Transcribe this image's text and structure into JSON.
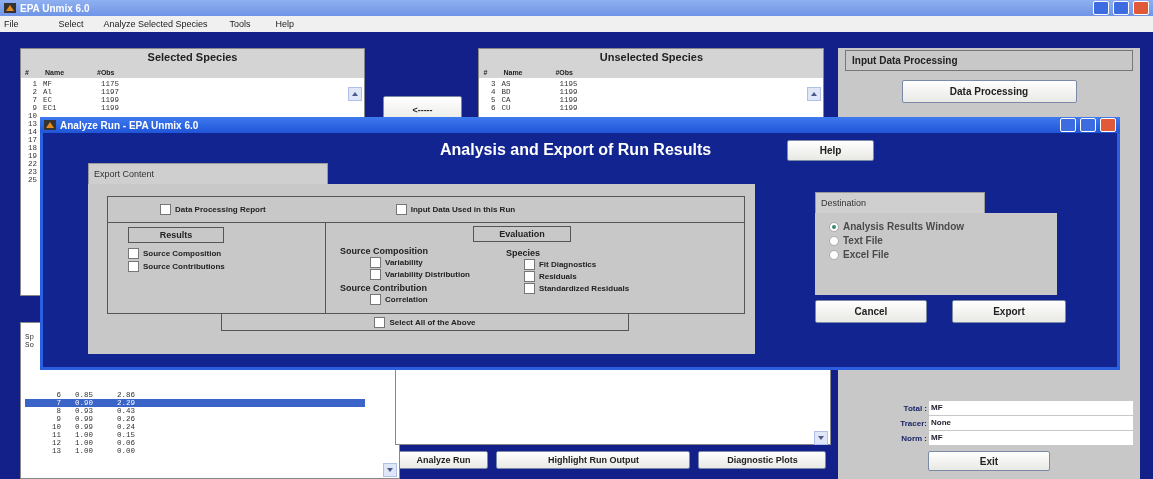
{
  "window": {
    "title": "EPA Unmix 6.0"
  },
  "menu": [
    "File",
    "Select",
    "Analyze Selected Species",
    "Tools",
    "Help"
  ],
  "selected_species": {
    "title": "Selected Species",
    "columns": [
      "#",
      "Name",
      "#Obs"
    ],
    "rows": [
      {
        "cells": [
          "1",
          "MF",
          "1175"
        ]
      },
      {
        "cells": [
          "2",
          "Al",
          "1197"
        ]
      },
      {
        "cells": [
          "7",
          "EC",
          "1199"
        ]
      },
      {
        "cells": [
          "9",
          "EC1",
          "1199"
        ]
      },
      {
        "cells": [
          "10"
        ]
      },
      {
        "cells": [
          "13"
        ]
      },
      {
        "cells": [
          "14"
        ]
      },
      {
        "cells": [
          "17"
        ]
      },
      {
        "cells": [
          "18"
        ]
      },
      {
        "cells": [
          "19"
        ]
      },
      {
        "cells": [
          "22"
        ]
      },
      {
        "cells": [
          "23"
        ]
      },
      {
        "cells": [
          "25"
        ]
      }
    ]
  },
  "move_button": "<-----",
  "unselected_species": {
    "title": "Unselected Species",
    "columns": [
      "#",
      "Name",
      "#Obs"
    ],
    "rows": [
      {
        "cells": [
          "3",
          "AS",
          "1195"
        ]
      },
      {
        "cells": [
          "4",
          "BD",
          "1199"
        ]
      },
      {
        "cells": [
          "5",
          "CA",
          "1199"
        ]
      },
      {
        "cells": [
          "6",
          "CU",
          "1199"
        ]
      }
    ]
  },
  "input_panel": {
    "title": "Input Data Processing",
    "button": "Data Processing"
  },
  "results_list": {
    "header": [
      "Sp",
      "So"
    ],
    "rows": [
      {
        "cells": [
          "6",
          "0.85",
          "2.86"
        ],
        "selected": false
      },
      {
        "cells": [
          "7",
          "0.90",
          "2.29"
        ],
        "selected": true
      },
      {
        "cells": [
          "8",
          "0.93",
          "0.43"
        ],
        "selected": false
      },
      {
        "cells": [
          "9",
          "0.99",
          "0.26"
        ],
        "selected": false
      },
      {
        "cells": [
          "10",
          "0.99",
          "0.24"
        ],
        "selected": false
      },
      {
        "cells": [
          "11",
          "1.00",
          "0.15"
        ],
        "selected": false
      },
      {
        "cells": [
          "12",
          "1.00",
          "0.06"
        ],
        "selected": false
      },
      {
        "cells": [
          "13",
          "1.00",
          "0.00"
        ],
        "selected": false
      }
    ]
  },
  "run_buttons": [
    "Analyze Run",
    "Highlight Run Output",
    "Diagnostic Plots"
  ],
  "species_summary": [
    {
      "label": "Total :",
      "value": "MF"
    },
    {
      "label": "Tracer:",
      "value": "None"
    },
    {
      "label": "Norm :",
      "value": "MF"
    }
  ],
  "exit_button": "Exit",
  "dialog": {
    "title": "Analyze Run - EPA Unmix 6.0",
    "heading": "Analysis and Export of Run Results",
    "help_button": "Help",
    "export_tab": "Export Content",
    "top_options": [
      {
        "label": "Data Processing Report",
        "checked": false
      },
      {
        "label": "Input Data Used in this Run",
        "checked": false
      }
    ],
    "results": {
      "title": "Results",
      "options": [
        {
          "label": "Source Composition",
          "checked": false
        },
        {
          "label": "Source Contributions",
          "checked": false
        }
      ]
    },
    "evaluation": {
      "title": "Evaluation",
      "columns": [
        [
          {
            "title": "Source Composition",
            "options": [
              {
                "label": "Variability",
                "checked": false
              },
              {
                "label": "Variability Distribution",
                "checked": false
              }
            ]
          },
          {
            "title": "Source Contribution",
            "options": [
              {
                "label": "Correlation",
                "checked": false
              }
            ]
          }
        ],
        [
          {
            "title": "Species",
            "options": [
              {
                "label": "Fit Diagnostics",
                "checked": false
              },
              {
                "label": "Residuals",
                "checked": false
              },
              {
                "label": "Standardized Residuals",
                "checked": false
              }
            ]
          }
        ]
      ]
    },
    "select_all": {
      "label": "Select All of the Above",
      "checked": false
    },
    "destination": {
      "title": "Destination",
      "options": [
        {
          "label": "Analysis Results Window",
          "selected": true
        },
        {
          "label": "Text File",
          "selected": false
        },
        {
          "label": "Excel File",
          "selected": false
        }
      ]
    },
    "buttons": [
      "Cancel",
      "Export"
    ]
  }
}
